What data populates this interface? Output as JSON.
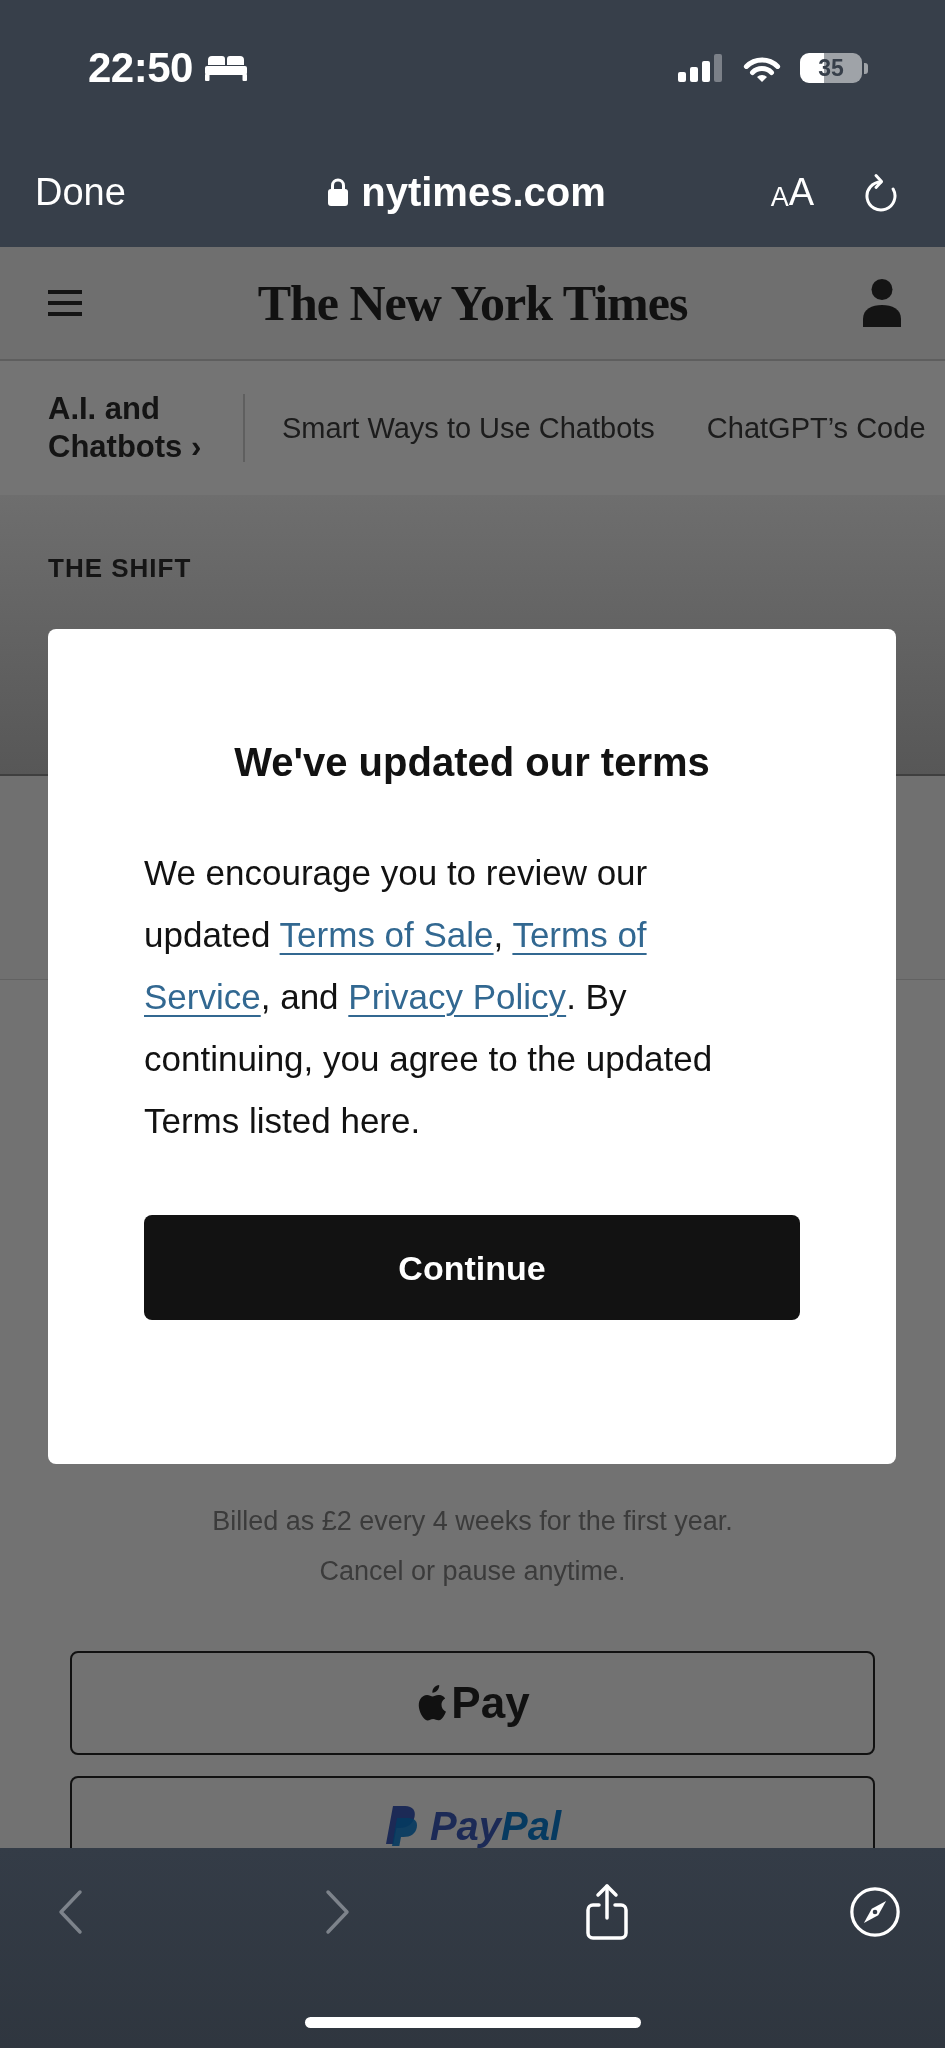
{
  "status_bar": {
    "time": "22:50",
    "battery": "35"
  },
  "browser_bar": {
    "done": "Done",
    "domain": "nytimes.com",
    "text_size": [
      "A",
      "A"
    ]
  },
  "site_header": {
    "logo": "The New York Times"
  },
  "section_nav": {
    "section": "A.I. and Chatbots ›",
    "links": [
      {
        "label": "Smart Ways to Use Chatbots"
      },
      {
        "label": "ChatGPT’s Code"
      }
    ]
  },
  "section_label": "THE SHIFT",
  "dialog": {
    "title": "We've updated our terms",
    "body": [
      {
        "kind": "text",
        "text": "We encourage you to review our updated "
      },
      {
        "kind": "link",
        "text": "Terms of Sale"
      },
      {
        "kind": "text",
        "text": ", "
      },
      {
        "kind": "link",
        "text": "Terms of "
      },
      {
        "kind": "link",
        "text": "Service"
      },
      {
        "kind": "text",
        "text": ", and "
      },
      {
        "kind": "link",
        "text": "Privacy Policy"
      },
      {
        "kind": "text",
        "text": ". By continuing, you agree to the updated Terms listed here."
      }
    ],
    "button": "Continue"
  },
  "offer": {
    "note_lines": [
      "Billed as £2 every 4 weeks for the first year.",
      "Cancel or pause anytime."
    ],
    "payment_buttons": [
      {
        "kind": "apple_pay",
        "label": "Pay"
      },
      {
        "kind": "paypal",
        "label_parts": [
          "Pay",
          "Pal"
        ]
      }
    ]
  },
  "toolbar": {
    "buttons": [
      {
        "kind": "back",
        "disabled": true
      },
      {
        "kind": "forward",
        "disabled": true
      },
      {
        "kind": "share",
        "disabled": false
      },
      {
        "kind": "compass",
        "disabled": false
      }
    ]
  }
}
